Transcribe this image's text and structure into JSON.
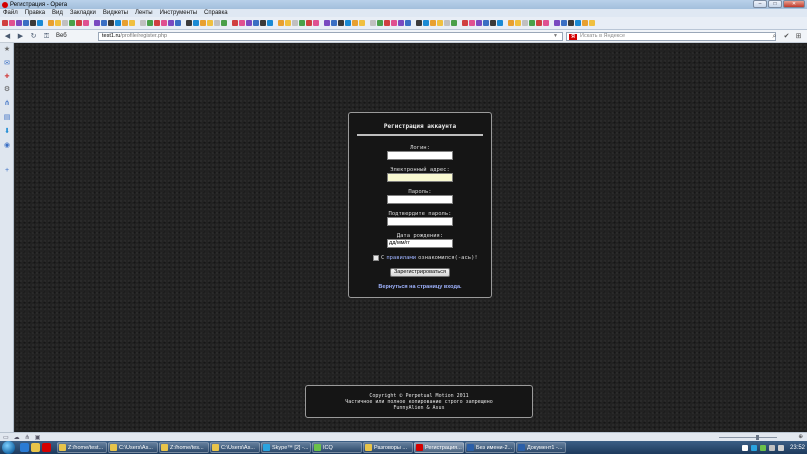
{
  "window": {
    "title": "Регистрация - Opera"
  },
  "menu": [
    "Файл",
    "Правка",
    "Вид",
    "Закладки",
    "Виджеты",
    "Ленты",
    "Инструменты",
    "Справка"
  ],
  "address_bar": {
    "speed_dial_label": "Веб",
    "url_host": "test1.ru",
    "url_path": "/profile/register.php",
    "search_placeholder": "Искать в Яндексе",
    "search_engine_letter": "Я"
  },
  "registration": {
    "title": "Регистрация аккаунта",
    "login_label": "Логин:",
    "login_value": "",
    "email_label": "Электронный адрес:",
    "email_value": "",
    "password_label": "Пароль:",
    "password_value": "",
    "confirm_label": "Подтвердите пароль:",
    "confirm_value": "",
    "birthdate_label": "Дата рождения:",
    "birthdate_value": "дд/мм/гг",
    "rules_prefix": "С",
    "rules_link": "правилами",
    "rules_suffix": "ознакомился(-ась)!",
    "rules_checked": false,
    "submit_label": "Зарегистрироваться",
    "back_link": "Вернуться на страницу входа."
  },
  "footer": {
    "line1": "Copyright © Perpetual Motion 2011",
    "line2": "Частичное или полное копирование строго запрещено",
    "line3": "FunnyAlien & Asus"
  },
  "taskbar": {
    "tasks": [
      {
        "label": "Z:/home/test...",
        "icon_color": "#e8c44a"
      },
      {
        "label": "C:\\Users\\As...",
        "icon_color": "#e8c44a"
      },
      {
        "label": "Z:/home/tes...",
        "icon_color": "#e8c44a"
      },
      {
        "label": "C:\\Users\\As...",
        "icon_color": "#e8c44a"
      },
      {
        "label": "Skype™ [2] -...",
        "icon_color": "#2aa4e0"
      },
      {
        "label": "ICQ",
        "icon_color": "#6bc14a"
      },
      {
        "label": "Разговоры ...",
        "icon_color": "#e8c44a"
      },
      {
        "label": "Регистрация...",
        "icon_color": "#d40000",
        "active": true
      },
      {
        "label": "Без имени-2...",
        "icon_color": "#2b5fa8"
      },
      {
        "label": "Документ1 -...",
        "icon_color": "#2b5fa8"
      }
    ],
    "clock": "23:52"
  },
  "colors": {
    "page_background": "#222222",
    "panel_background": "#151515",
    "link": "#9fb3ff",
    "opera_red": "#d40000"
  }
}
